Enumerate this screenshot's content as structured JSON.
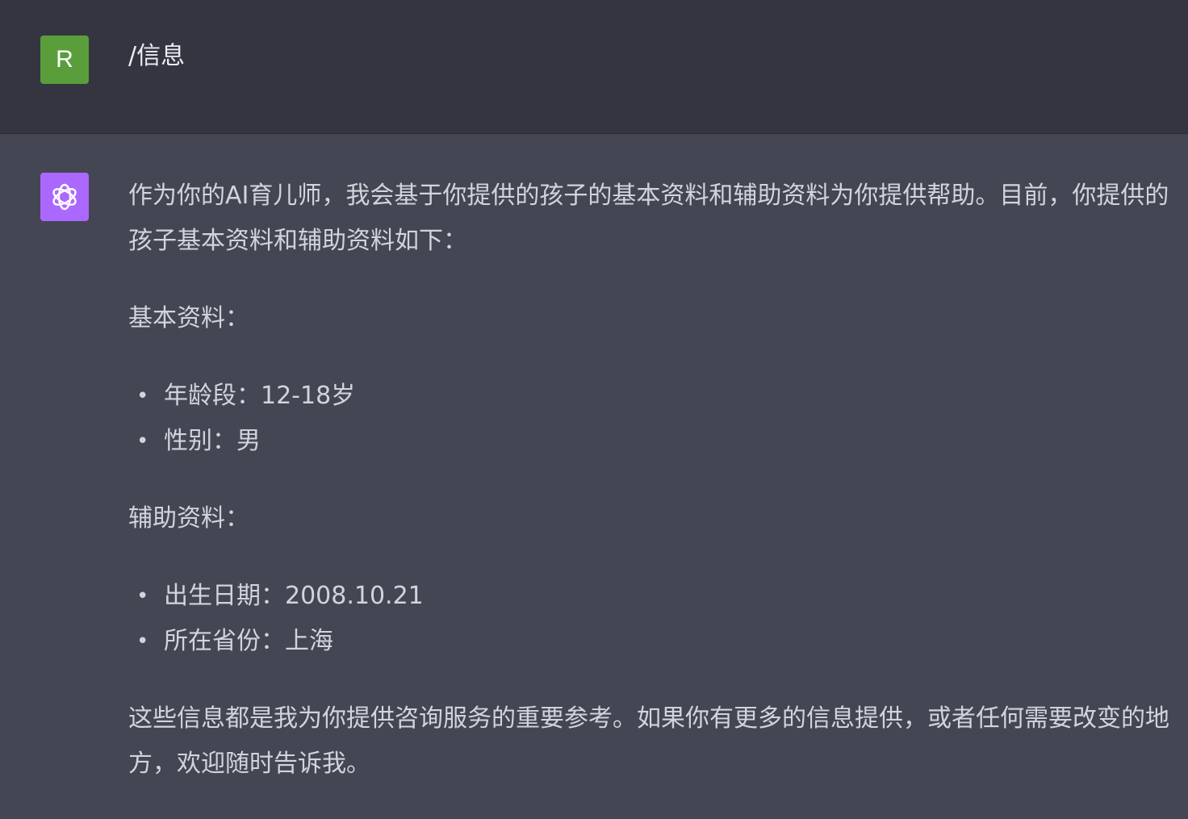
{
  "user_message": {
    "avatar_letter": "R",
    "text": "/信息"
  },
  "assistant_message": {
    "intro": "作为你的AI育儿师，我会基于你提供的孩子的基本资料和辅助资料为你提供帮助。目前，你提供的孩子基本资料和辅助资料如下：",
    "basic_heading": "基本资料：",
    "basic_items": [
      "年龄段：12-18岁",
      "性别：男"
    ],
    "aux_heading": "辅助资料：",
    "aux_items": [
      "出生日期：2008.10.21",
      "所在省份：上海"
    ],
    "closing": "这些信息都是我为你提供咨询服务的重要参考。如果你有更多的信息提供，或者任何需要改变的地方，欢迎随时告诉我。"
  },
  "colors": {
    "user_bg": "#343541",
    "assistant_bg": "#444654",
    "user_avatar": "#5a9e3c",
    "bot_avatar": "#ab68ff"
  },
  "icons": {
    "bot_avatar": "openai-logo-icon"
  }
}
